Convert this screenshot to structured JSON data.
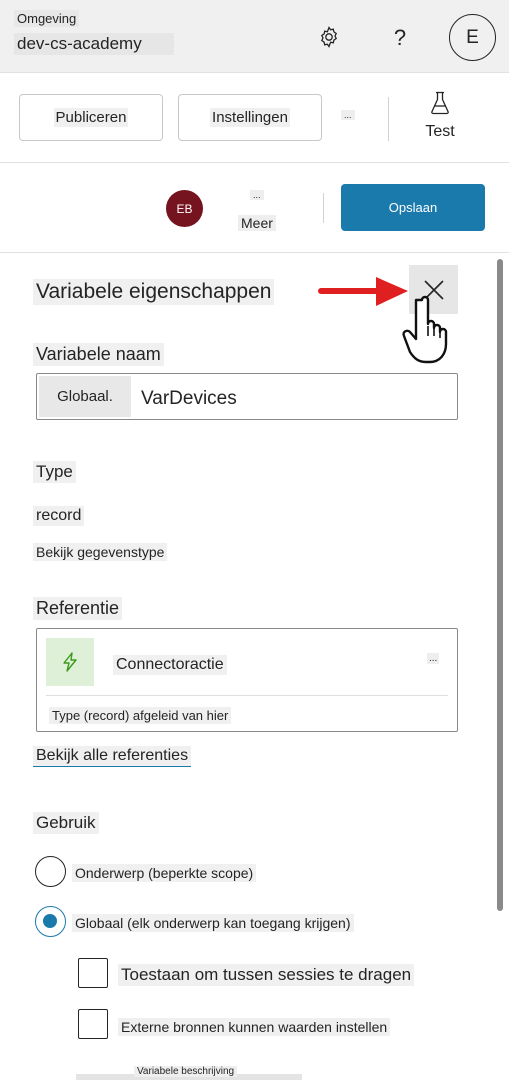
{
  "env": {
    "label": "Omgeving",
    "name": "dev-cs-academy"
  },
  "header": {
    "help": "?",
    "user_initial": "E"
  },
  "toolbar": {
    "publish": "Publiceren",
    "settings": "Instellingen",
    "more_dots": "...",
    "test": "Test"
  },
  "bar2": {
    "user_initials": "EB",
    "more_dots": "...",
    "more": "Meer",
    "save": "Opslaan"
  },
  "panel": {
    "title": "Variabele eigenschappen",
    "variable_name_label": "Variabele naam",
    "prefix": "Globaal.",
    "variable_name": "VarDevices",
    "type_label": "Type",
    "type_value": "record",
    "type_link": "Bekijk gegevenstype",
    "reference_label": "Referentie",
    "reference_name": "Connectoractie",
    "reference_dots": "...",
    "reference_sub": "Type (record) afgeleid van hier",
    "all_refs_link": "Bekijk alle referenties",
    "usage_label": "Gebruik",
    "usage_options": [
      {
        "label": "Onderwerp (beperkte scope)",
        "checked": false
      },
      {
        "label": "Globaal (elk onderwerp kan toegang krijgen)",
        "checked": true
      }
    ],
    "checkboxes": [
      {
        "label": "Toestaan om tussen sessies te dragen",
        "checked": false
      },
      {
        "label": "Externe bronnen kunnen waarden instellen",
        "checked": false
      }
    ],
    "description_label": "Variabele beschrijving"
  },
  "colors": {
    "accent": "#1a7aab",
    "avatar_bg": "#75131f",
    "annotation_arrow": "#e02020",
    "connector_icon_bg": "#dff0d8"
  }
}
